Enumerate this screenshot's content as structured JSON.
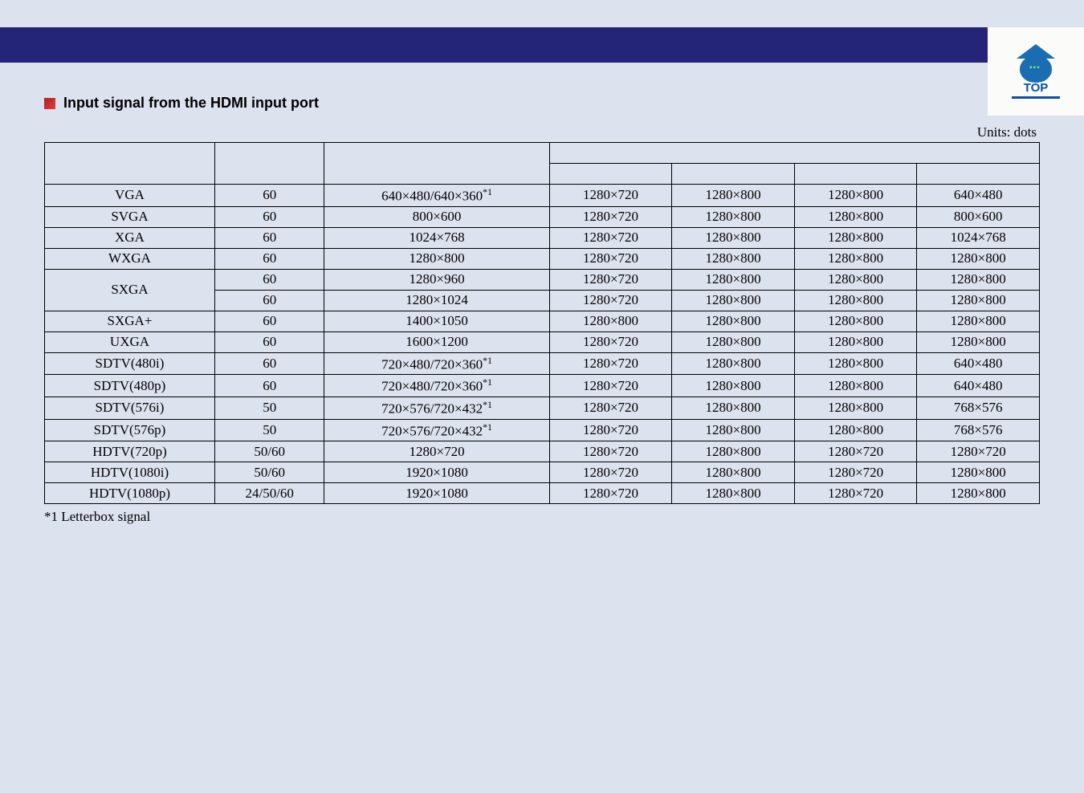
{
  "icon_label": "TOP",
  "section_title": "Input signal from the HDMI input port",
  "units_label": "Units: dots",
  "footnote": "*1 Letterbox signal",
  "sup_mark": "*1",
  "rows": [
    {
      "signal": "VGA",
      "refresh": "60",
      "res_main": "640×480/640×360",
      "sup": true,
      "d1": "1280×720",
      "d2": "1280×800",
      "d3": "1280×800",
      "d4": "640×480"
    },
    {
      "signal": "SVGA",
      "refresh": "60",
      "res_main": "800×600",
      "sup": false,
      "d1": "1280×720",
      "d2": "1280×800",
      "d3": "1280×800",
      "d4": "800×600"
    },
    {
      "signal": "XGA",
      "refresh": "60",
      "res_main": "1024×768",
      "sup": false,
      "d1": "1280×720",
      "d2": "1280×800",
      "d3": "1280×800",
      "d4": "1024×768"
    },
    {
      "signal": "WXGA",
      "refresh": "60",
      "res_main": "1280×800",
      "sup": false,
      "d1": "1280×720",
      "d2": "1280×800",
      "d3": "1280×800",
      "d4": "1280×800"
    },
    {
      "signal": "SXGA",
      "refresh": "60",
      "res_main": "1280×960",
      "sup": false,
      "d1": "1280×720",
      "d2": "1280×800",
      "d3": "1280×800",
      "d4": "1280×800",
      "rowspan": 2
    },
    {
      "signal": "",
      "refresh": "60",
      "res_main": "1280×1024",
      "sup": false,
      "d1": "1280×720",
      "d2": "1280×800",
      "d3": "1280×800",
      "d4": "1280×800",
      "skip_signal": true
    },
    {
      "signal": "SXGA+",
      "refresh": "60",
      "res_main": "1400×1050",
      "sup": false,
      "d1": "1280×800",
      "d2": "1280×800",
      "d3": "1280×800",
      "d4": "1280×800"
    },
    {
      "signal": "UXGA",
      "refresh": "60",
      "res_main": "1600×1200",
      "sup": false,
      "d1": "1280×720",
      "d2": "1280×800",
      "d3": "1280×800",
      "d4": "1280×800"
    },
    {
      "signal": "SDTV(480i)",
      "refresh": "60",
      "res_main": "720×480/720×360",
      "sup": true,
      "d1": "1280×720",
      "d2": "1280×800",
      "d3": "1280×800",
      "d4": "640×480"
    },
    {
      "signal": "SDTV(480p)",
      "refresh": "60",
      "res_main": "720×480/720×360",
      "sup": true,
      "d1": "1280×720",
      "d2": "1280×800",
      "d3": "1280×800",
      "d4": "640×480"
    },
    {
      "signal": "SDTV(576i)",
      "refresh": "50",
      "res_main": "720×576/720×432",
      "sup": true,
      "d1": "1280×720",
      "d2": "1280×800",
      "d3": "1280×800",
      "d4": "768×576"
    },
    {
      "signal": "SDTV(576p)",
      "refresh": "50",
      "res_main": "720×576/720×432",
      "sup": true,
      "d1": "1280×720",
      "d2": "1280×800",
      "d3": "1280×800",
      "d4": "768×576"
    },
    {
      "signal": "HDTV(720p)",
      "refresh": "50/60",
      "res_main": "1280×720",
      "sup": false,
      "d1": "1280×720",
      "d2": "1280×800",
      "d3": "1280×720",
      "d4": "1280×720"
    },
    {
      "signal": "HDTV(1080i)",
      "refresh": "50/60",
      "res_main": "1920×1080",
      "sup": false,
      "d1": "1280×720",
      "d2": "1280×800",
      "d3": "1280×720",
      "d4": "1280×800"
    },
    {
      "signal": "HDTV(1080p)",
      "refresh": "24/50/60",
      "res_main": "1920×1080",
      "sup": false,
      "d1": "1280×720",
      "d2": "1280×800",
      "d3": "1280×720",
      "d4": "1280×800"
    }
  ]
}
